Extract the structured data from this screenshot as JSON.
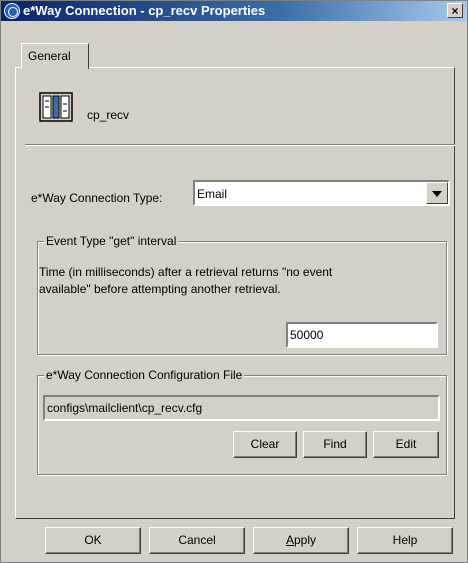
{
  "window": {
    "title": "e*Way Connection - cp_recv Properties",
    "close_glyph": "×"
  },
  "tabs": [
    {
      "label": "General",
      "selected": true
    }
  ],
  "general": {
    "icon": "connection-icon",
    "connection_name": "cp_recv",
    "connection_type_label": "e*Way Connection Type:",
    "connection_type_value": "Email"
  },
  "event_interval": {
    "legend": "Event Type \"get\" interval",
    "description": "Time (in milliseconds) after a retrieval returns \"no event available\" before attempting another retrieval.",
    "value": "50000"
  },
  "config_file": {
    "legend": "e*Way Connection Configuration File",
    "path": "configs\\mailclient\\cp_recv.cfg",
    "buttons": {
      "clear": "Clear",
      "find": "Find",
      "edit": "Edit"
    }
  },
  "footer": {
    "ok": "OK",
    "cancel": "Cancel",
    "apply_first": "A",
    "apply_rest": "pply",
    "help": "Help"
  },
  "colors": {
    "face": "#d4d0c8",
    "titlebar": "#0a246a",
    "field": "#ffffff"
  }
}
